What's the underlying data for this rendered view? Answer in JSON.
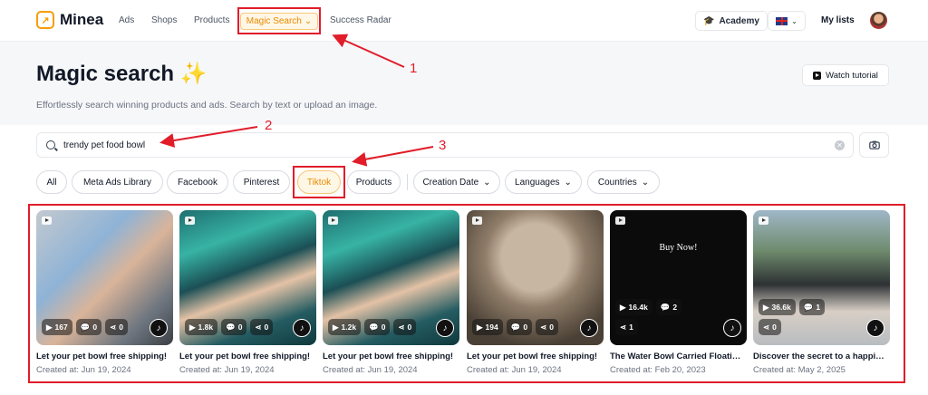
{
  "nav": {
    "brand": "Minea",
    "items": [
      "Ads",
      "Shops",
      "Products"
    ],
    "active": "Magic Search",
    "extra": "Success Radar",
    "academy": "Academy",
    "my_lists": "My lists"
  },
  "header": {
    "title": "Magic search",
    "sparkle": "✨",
    "subtitle": "Effortlessly search winning products and ads. Search by text or upload an image.",
    "tutorial": "Watch tutorial"
  },
  "search": {
    "value": "trendy pet food bowl"
  },
  "filters": {
    "sources": [
      "All",
      "Meta Ads Library",
      "Facebook",
      "Pinterest",
      "Tiktok",
      "Products"
    ],
    "active_source": "Tiktok",
    "dropdowns": [
      "Creation Date",
      "Languages",
      "Countries"
    ]
  },
  "results": [
    {
      "views": "167",
      "comments": "0",
      "shares": "0",
      "title": "Let your pet bowl free shipping!",
      "date": "Created at: Jun 19, 2024"
    },
    {
      "views": "1.8k",
      "comments": "0",
      "shares": "0",
      "title": "Let your pet bowl free shipping!",
      "date": "Created at: Jun 19, 2024"
    },
    {
      "views": "1.2k",
      "comments": "0",
      "shares": "0",
      "title": "Let your pet bowl free shipping!",
      "date": "Created at: Jun 19, 2024"
    },
    {
      "views": "194",
      "comments": "0",
      "shares": "0",
      "title": "Let your pet bowl free shipping!",
      "date": "Created at: Jun 19, 2024"
    },
    {
      "views": "16.4k",
      "comments": "2",
      "shares": "1",
      "title": "The Water Bowl Carried Floati…",
      "date": "Created at: Feb 20, 2023",
      "overlay": "Buy Now!"
    },
    {
      "views": "36.6k",
      "comments": "1",
      "shares": "0",
      "title": "Discover the secret to a happi…",
      "date": "Created at: May 2, 2025"
    }
  ],
  "annotations": [
    "1",
    "2",
    "3"
  ],
  "colors": {
    "accent": "#ea8a00",
    "annotation": "#e11d2a"
  }
}
